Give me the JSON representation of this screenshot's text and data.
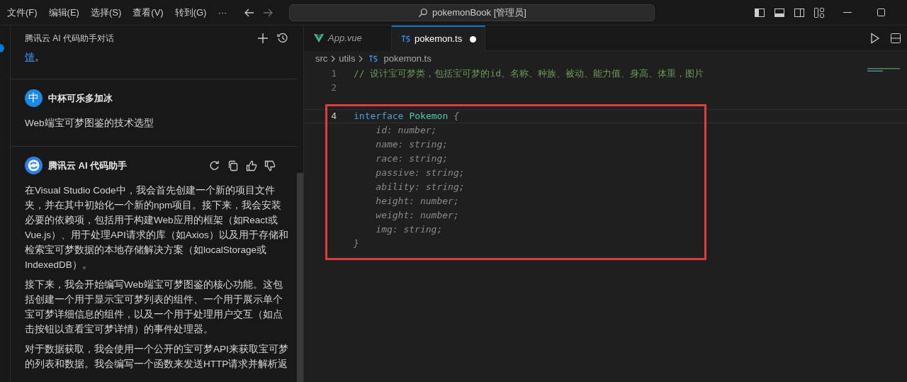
{
  "menu": [
    {
      "label": "文件(F)"
    },
    {
      "label": "编辑(E)"
    },
    {
      "label": "选择(S)"
    },
    {
      "label": "查看(V)"
    },
    {
      "label": "转到(G)"
    },
    {
      "label": "···"
    }
  ],
  "command_center": {
    "text": "pokemonBook [管理员]"
  },
  "chat": {
    "title": "腾讯云 AI 代码助手对话",
    "cut_message": {
      "link": "馈",
      "text": "。"
    },
    "messages": [
      {
        "kind": "user",
        "avatar": "中",
        "author": "中杯可乐多加冰",
        "paragraphs": [
          "Web端宝可梦图鉴的技术选型"
        ]
      },
      {
        "kind": "assistant",
        "author": "腾讯云 AI 代码助手",
        "paragraphs": [
          "在Visual Studio Code中，我会首先创建一个新的项目文件夹，并在其中初始化一个新的npm项目。接下来，我会安装必要的依赖项，包括用于构建Web应用的框架（如React或Vue.js）、用于处理API请求的库（如Axios）以及用于存储和检索宝可梦数据的本地存储解决方案（如localStorage或IndexedDB）。",
          "接下来，我会开始编写Web端宝可梦图鉴的核心功能。这包括创建一个用于显示宝可梦列表的组件、一个用于展示单个宝可梦详细信息的组件，以及一个用于处理用户交互（如点击按钮以查看宝可梦详情）的事件处理器。",
          "对于数据获取，我会使用一个公开的宝可梦API来获取宝可梦的列表和数据。我会编写一个函数来发送HTTP请求并解析返"
        ]
      }
    ]
  },
  "tabs": [
    {
      "label": "App.vue",
      "kind": "vue",
      "selected": false,
      "modified": false
    },
    {
      "label": "pokemon.ts",
      "kind": "ts",
      "selected": true,
      "modified": true
    }
  ],
  "breadcrumb": [
    {
      "label": "src",
      "kind": "folder"
    },
    {
      "label": "utils",
      "kind": "folder"
    },
    {
      "label": "pokemon.ts",
      "kind": "ts"
    }
  ],
  "code": [
    {
      "number": "1",
      "current": false,
      "tokens": [
        {
          "kind": "comment",
          "text": "// 设计宝可梦类，包括宝可梦的id、名称、种族、被动、能力值、身高、体重，图片"
        }
      ]
    },
    {
      "number": "2",
      "current": false
    },
    {
      "current": false
    },
    {
      "number": "4",
      "current": true,
      "tokens": [
        {
          "kind": "keyword",
          "text": "interface"
        },
        {
          "kind": "type",
          "text": "Pokemon"
        },
        {
          "kind": "ghost",
          "text": "{"
        }
      ]
    },
    {
      "tokens": [
        {
          "kind": "ghost",
          "text": "    id: number;"
        }
      ]
    },
    {
      "tokens": [
        {
          "kind": "ghost",
          "text": "    name: string;"
        }
      ]
    },
    {
      "tokens": [
        {
          "kind": "ghost",
          "text": "    race: string;"
        }
      ]
    },
    {
      "tokens": [
        {
          "kind": "ghost",
          "text": "    passive: string;"
        }
      ]
    },
    {
      "tokens": [
        {
          "kind": "ghost",
          "text": "    ability: string;"
        }
      ]
    },
    {
      "tokens": [
        {
          "kind": "ghost",
          "text": "    height: number;"
        }
      ]
    },
    {
      "tokens": [
        {
          "kind": "ghost",
          "text": "    weight: number;"
        }
      ]
    },
    {
      "tokens": [
        {
          "kind": "ghost",
          "text": "    img: string;"
        }
      ]
    },
    {
      "tokens": [
        {
          "kind": "ghost",
          "text": "}"
        }
      ]
    }
  ]
}
